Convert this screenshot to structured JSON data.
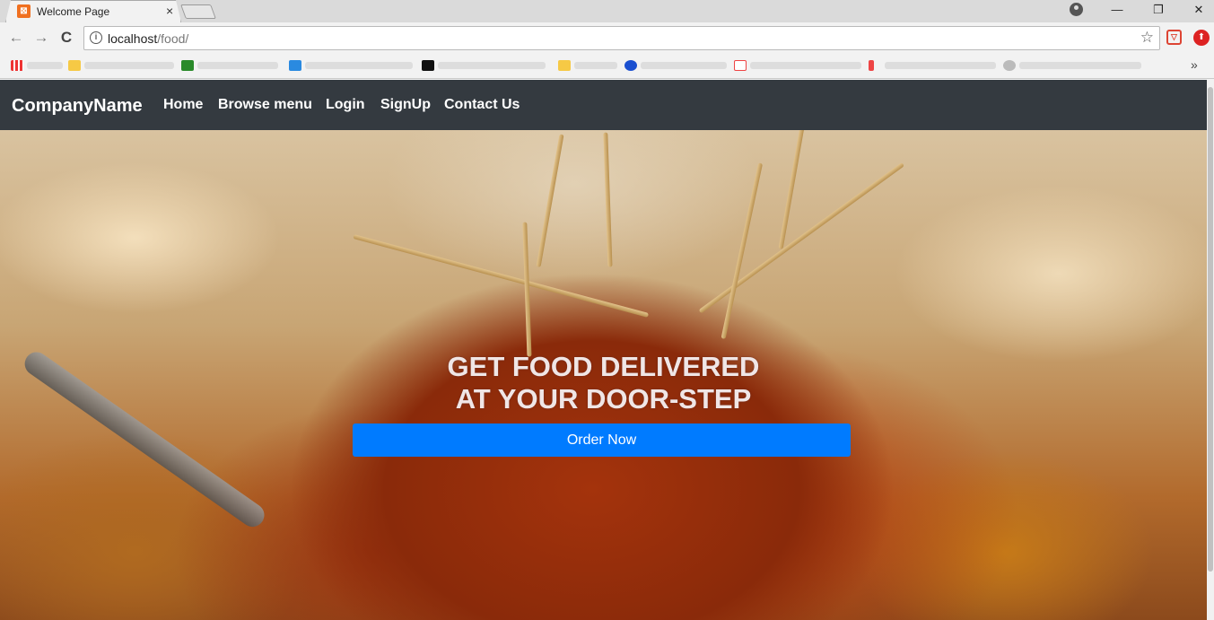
{
  "browser": {
    "tab_title": "Welcome Page",
    "tab_close": "×",
    "url_host": "localhost",
    "url_path": "/food/",
    "back": "←",
    "forward": "→",
    "reload": "C",
    "star": "☆",
    "minimize": "—",
    "restore": "❐",
    "close": "✕",
    "bookmarks_more": "»"
  },
  "navbar": {
    "brand": "CompanyName",
    "links": [
      "Home",
      "Browse menu",
      "Login",
      "SignUp",
      "Contact Us"
    ]
  },
  "hero": {
    "title_line1": "GET FOOD DELIVERED",
    "title_line2": "AT YOUR DOOR-STEP",
    "cta": "Order Now"
  },
  "colors": {
    "navbar_bg": "#343a40",
    "cta_bg": "#007bff"
  }
}
